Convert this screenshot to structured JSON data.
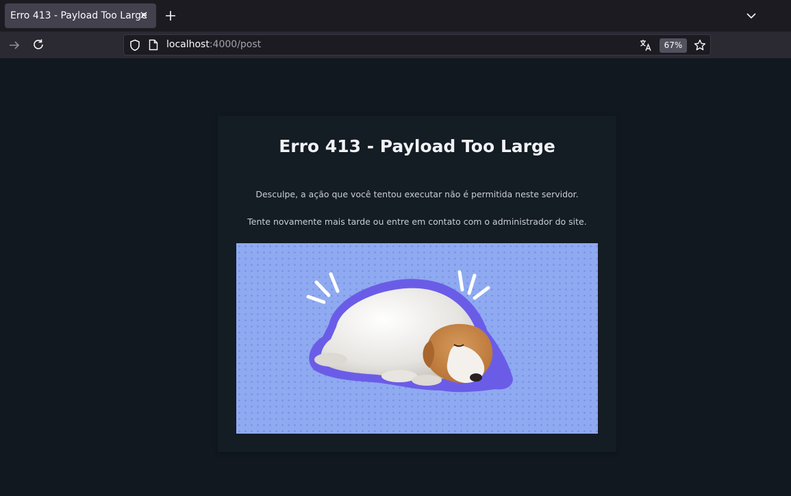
{
  "browser": {
    "tab_title": "Erro 413 - Payload Too Large",
    "tab_close": "×",
    "url_host": "localhost",
    "url_path": ":4000/post",
    "zoom": "67%"
  },
  "icons": {
    "new_tab": "plus-icon",
    "tab_list": "chevron-down-icon",
    "forward": "arrow-right-icon",
    "reload": "reload-icon",
    "security": "shield-icon",
    "page": "page-icon",
    "translate": "translate-icon",
    "bookmark": "star-icon"
  },
  "page": {
    "title": "Erro 413 - Payload Too Large",
    "message1": "Desculpe, a ação que você tentou executar não é permitida neste servidor.",
    "message2": "Tente novamente mais tarde ou entre em contato com o administrador do site."
  },
  "colors": {
    "page_bg": "#111820",
    "card_bg": "#141c24",
    "illustration_bg": "#8faaf0",
    "outline": "#6b5ce8"
  }
}
